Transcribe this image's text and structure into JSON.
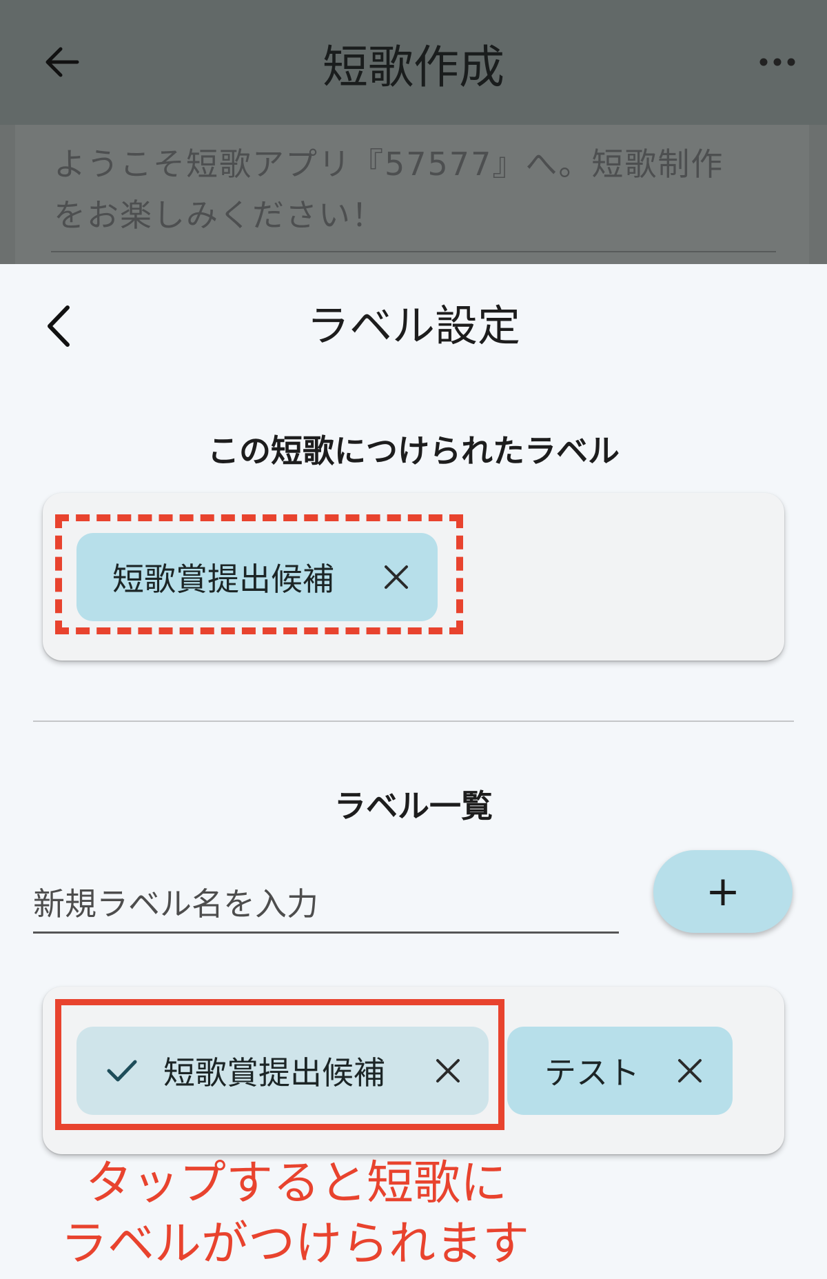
{
  "appbar": {
    "title": "短歌作成",
    "back_icon": "arrow-left-icon",
    "more_icon": "more-horizontal-icon"
  },
  "underlay": {
    "welcome_text": "ようこそ短歌アプリ『57577』へ。短歌制作をお楽しみください！"
  },
  "sheet": {
    "title": "ラベル設定",
    "back_icon": "chevron-left-icon",
    "attached_section_title": "この短歌につけられたラベル",
    "attached_labels": [
      {
        "label": "短歌賞提出候補"
      }
    ],
    "list_section_title": "ラベル一覧",
    "new_label_placeholder": "新規ラベル名を入力",
    "add_button_label": "+",
    "label_list": [
      {
        "label": "短歌賞提出候補",
        "selected": true
      },
      {
        "label": "テスト",
        "selected": false
      }
    ]
  },
  "annotation": {
    "line1": "タップすると短歌に",
    "line2": "ラベルがつけられます"
  },
  "colors": {
    "chip": "#b7dfea",
    "chip_selected": "#cfe4ea",
    "highlight": "#e8432e",
    "appbar": "#626968"
  }
}
